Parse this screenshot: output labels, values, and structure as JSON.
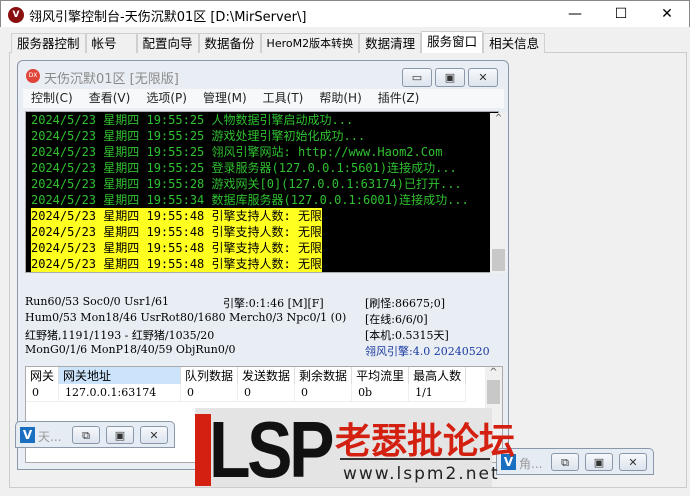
{
  "window": {
    "title": "翎风引擎控制台-天伤沉默01区 [D:\\MirServer\\]",
    "minimize": "—",
    "maximize": "☐",
    "close": "✕"
  },
  "tabs": [
    "服务器控制",
    "帐号",
    "配置向导",
    "数据备份",
    "HeroM2版本转换",
    "数据清理",
    "服务窗口",
    "相关信息"
  ],
  "active_tab": "服务窗口",
  "mdi": {
    "title": "天伤沉默01区 [无限版]",
    "icon": "DX",
    "menu": [
      "控制(C)",
      "查看(V)",
      "选项(P)",
      "管理(M)",
      "工具(T)",
      "帮助(H)",
      "插件(Z)"
    ]
  },
  "log": [
    "2024/5/23 星期四 19:55:25 人物数据引擎启动成功...",
    "2024/5/23 星期四 19:55:25 游戏处理引擎初始化成功...",
    "2024/5/23 星期四 19:55:25 翎风引擎网站: http://www.Haom2.Com",
    "2024/5/23 星期四 19:55:25 登录服务器(127.0.0.1:5601)连接成功...",
    "2024/5/23 星期四 19:55:28 游戏网关[0](127.0.0.1:63174)已打开...",
    "2024/5/23 星期四 19:55:34 数据库服务器(127.0.0.1:6001)连接成功...",
    "2024/5/23 星期四 19:55:48 引擎支持人数: 无限",
    "2024/5/23 星期四 19:55:48 引擎支持人数: 无限",
    "2024/5/23 星期四 19:55:48 引擎支持人数: 无限",
    "2024/5/23 星期四 19:55:48 引擎支持人数: 无限"
  ],
  "status": {
    "l1": "Run60/53 Soc0/0 Usr1/61",
    "engine_time": "引擎:0:1:46 [M][F]",
    "refresh": "[刷怪:86675;0]",
    "l2": "Hum0/53 Mon18/46 UsrRot80/1680 Merch0/3 Npc0/1 (0)",
    "online": "[在线:6/6/0]",
    "l3": "红野猪,1191/1193 - 红野猪/1035/20",
    "local": "[本机:0.5315天]",
    "l4": "MonG0/1/6 MonP18/40/59 ObjRun0/0",
    "version": "翎风引擎:4.0 20240520"
  },
  "grid": {
    "columns": [
      "网关",
      "网关地址",
      "队列数据",
      "发送数据",
      "剩余数据",
      "平均流里",
      "最高人数"
    ],
    "rows": [
      [
        "0",
        "127.0.0.1:63174",
        "0",
        "0",
        "0",
        "0b",
        "1/1"
      ]
    ]
  },
  "minimized": [
    {
      "icon": "V",
      "title": "天..."
    },
    {
      "icon": "V",
      "title": "角..."
    }
  ],
  "watermark": {
    "logo": "LSP",
    "text": "老瑟批论坛",
    "url": "www.lspm2.net"
  },
  "colors": {
    "log_green": "#30c030",
    "log_highlight": "#ffff20",
    "version_blue": "#1a3aa0"
  }
}
